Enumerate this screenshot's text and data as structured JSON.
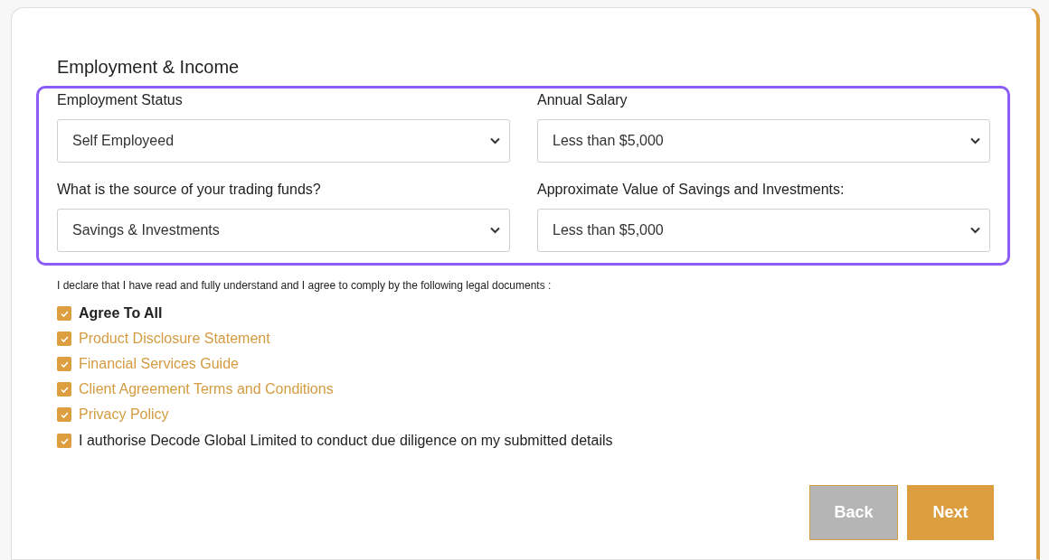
{
  "section": {
    "title": "Employment & Income"
  },
  "fields": [
    {
      "label": "Employment Status",
      "value": "Self Employeed"
    },
    {
      "label": "Annual Salary",
      "value": "Less than $5,000"
    },
    {
      "label": "What is the source of your trading funds?",
      "value": "Savings & Investments"
    },
    {
      "label": "Approximate Value of Savings and Investments:",
      "value": "Less than $5,000"
    }
  ],
  "declaration": "I declare that I have read and fully understand and I agree to comply by the following legal documents :",
  "agreements": [
    {
      "label": "Agree To All",
      "kind": "master",
      "checked": true
    },
    {
      "label": "Product Disclosure Statement",
      "kind": "link",
      "checked": true
    },
    {
      "label": "Financial Services Guide",
      "kind": "link",
      "checked": true
    },
    {
      "label": "Client Agreement Terms and Conditions",
      "kind": "link",
      "checked": true
    },
    {
      "label": "Privacy Policy",
      "kind": "link",
      "checked": true
    },
    {
      "label": "I authorise Decode Global Limited to conduct due diligence on my submitted details",
      "kind": "plain",
      "checked": true
    }
  ],
  "buttons": [
    {
      "label": "Back",
      "kind": "secondary"
    },
    {
      "label": "Next",
      "kind": "primary"
    }
  ]
}
